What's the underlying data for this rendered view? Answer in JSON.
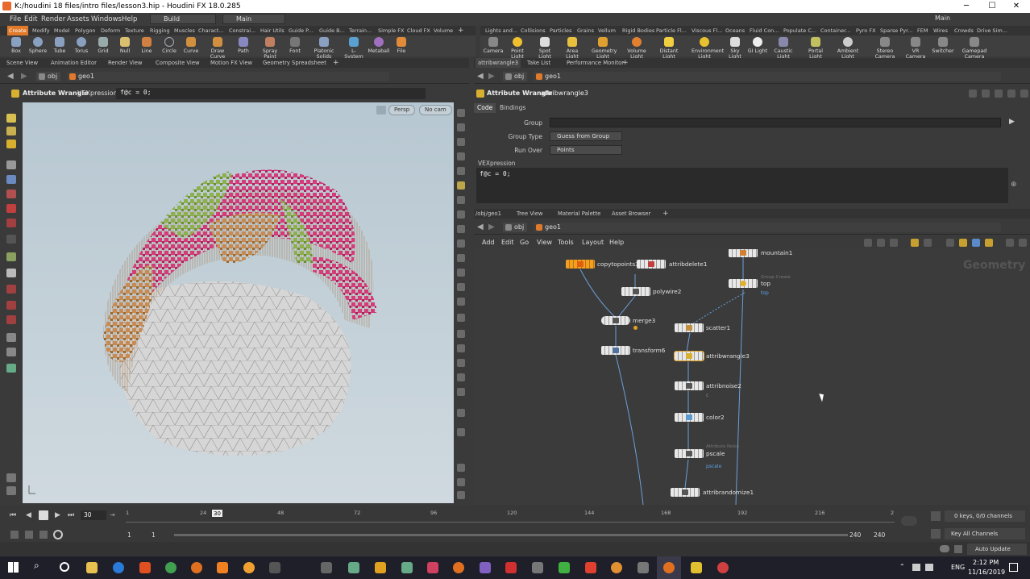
{
  "window": {
    "title": "K:/houdini 18 files/intro files/lesson3.hip - Houdini FX 18.0.285",
    "minimize": "─",
    "maximize": "☐",
    "close": "✕"
  },
  "menu": {
    "items": [
      "File",
      "Edit",
      "Render",
      "Assets",
      "Windows",
      "Help"
    ],
    "desktop_left": "Build",
    "desktop_mid": "Main",
    "desktop_right": "Main"
  },
  "shelf_left": {
    "tabs": [
      "Create",
      "Modify",
      "Model",
      "Polygon",
      "Deform",
      "Texture",
      "Rigging",
      "Muscles",
      "Charact...",
      "Constrai...",
      "Hair Utils",
      "Guide P...",
      "Guide B...",
      "Terrain...",
      "Simple FX",
      "Cloud FX",
      "Volume"
    ],
    "tools": [
      "Box",
      "Sphere",
      "Tube",
      "Torus",
      "Grid",
      "Null",
      "Line",
      "Circle",
      "Curve",
      "Draw Curve",
      "Path",
      "Spray Paint",
      "Font",
      "Platonic Solids",
      "L-System",
      "Metaball",
      "File"
    ]
  },
  "shelf_right": {
    "tabs": [
      "Lights and...",
      "Collisions",
      "Particles",
      "Grains",
      "Vellum",
      "Rigid Bodies",
      "Particle Fl...",
      "Viscous Fl...",
      "Oceans",
      "Fluid Con...",
      "Populate C...",
      "Container...",
      "Pyro FX",
      "Sparse Pyr...",
      "FEM",
      "Wires",
      "Crowds",
      "Drive Sim..."
    ],
    "tools": [
      "Camera",
      "Point Light",
      "Spot Light",
      "Area Light",
      "Geometry Light",
      "Volume Light",
      "Distant Light",
      "Environment Light",
      "Sky Light",
      "GI Light",
      "Caustic Light",
      "Portal Light",
      "Ambient Light",
      "Stereo Camera",
      "VR Camera",
      "Switcher",
      "Gamepad Camera"
    ]
  },
  "left_pane": {
    "tabs": [
      "Scene View",
      "Animation Editor",
      "Render View",
      "Composite View",
      "Motion FX View",
      "Geometry Spreadsheet"
    ],
    "path": [
      "obj",
      "geo1"
    ],
    "wrangle_label": "Attribute Wrangle",
    "vexpr_label": "VEXpression",
    "vexpr_value": "f@c = 0;",
    "persp": "Persp",
    "cam": "No cam"
  },
  "right_top": {
    "tabs": [
      "attribwrangle3",
      "Take List",
      "Performance Monitor"
    ],
    "path": [
      "obj",
      "geo1"
    ],
    "node_type": "Attribute Wrangle",
    "node_name": "attribwrangle3",
    "subtabs": [
      "Code",
      "Bindings"
    ],
    "group_label": "Group",
    "group_type_label": "Group Type",
    "group_type_value": "Guess from Group",
    "run_over_label": "Run Over",
    "run_over_value": "Points",
    "vex_label": "VEXpression",
    "vex_code": "f@c = 0;"
  },
  "right_bottom": {
    "tabs": [
      "/obj/geo1",
      "Tree View",
      "Material Palette",
      "Asset Browser"
    ],
    "path": [
      "obj",
      "geo1"
    ],
    "menu": [
      "Add",
      "Edit",
      "Go",
      "View",
      "Tools",
      "Layout",
      "Help"
    ],
    "context_label": "Geometry",
    "nodes": [
      {
        "name": "copytopoints3",
        "sub": "",
        "flag": ""
      },
      {
        "name": "attribdelete1",
        "sub": "",
        "flag": ""
      },
      {
        "name": "mountain1",
        "sub": "",
        "flag": ""
      },
      {
        "name": "top",
        "sub": "Group Create",
        "flag": "top"
      },
      {
        "name": "polywire2",
        "sub": "",
        "flag": ""
      },
      {
        "name": "merge3",
        "sub": "",
        "flag": ""
      },
      {
        "name": "scatter1",
        "sub": "",
        "flag": ""
      },
      {
        "name": "transform6",
        "sub": "",
        "flag": ""
      },
      {
        "name": "attribwrangle3",
        "sub": "",
        "flag": ""
      },
      {
        "name": "attribnoise2",
        "sub": "",
        "flag": "c"
      },
      {
        "name": "color2",
        "sub": "",
        "flag": ""
      },
      {
        "name": "pscale",
        "sub": "Attribute Noise",
        "flag": "pscale"
      },
      {
        "name": "attribrandomize1",
        "sub": "",
        "flag": ""
      }
    ]
  },
  "timeline": {
    "current_frame": "30",
    "marker": "30",
    "ticks": [
      "1",
      "24",
      "48",
      "72",
      "96",
      "120",
      "144",
      "168",
      "192",
      "216",
      "2"
    ],
    "range_start": "1",
    "range_start2": "1",
    "range_end": "240",
    "range_end2": "240",
    "keys_info": "0 keys, 0/0 channels",
    "key_all": "Key All Channels",
    "auto_update": "Auto Update"
  },
  "taskbar": {
    "lang": "ENG",
    "time": "2:12 PM",
    "date": "11/16/2019"
  }
}
